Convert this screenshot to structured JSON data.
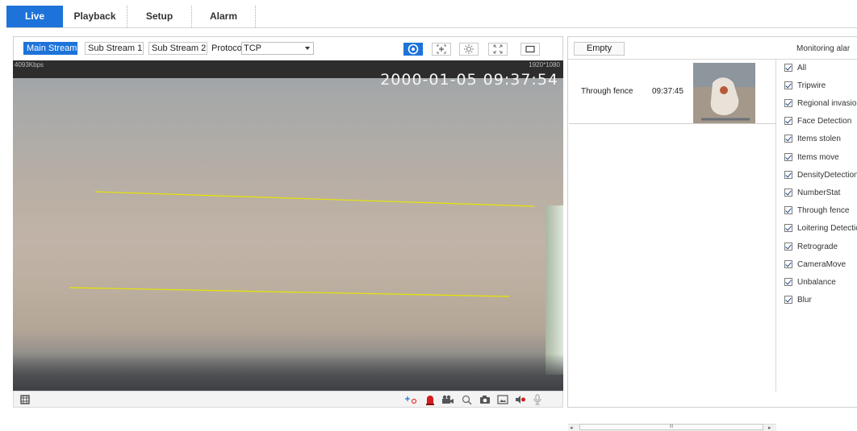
{
  "nav": {
    "tabs": [
      "Live",
      "Playback",
      "Setup",
      "Alarm"
    ],
    "active": "Live"
  },
  "live": {
    "streams": [
      "Main Stream",
      "Sub Stream 1",
      "Sub Stream 2"
    ],
    "active_stream": "Main Stream",
    "protocol_label": "Protocol",
    "protocol_value": "TCP",
    "toolbar_icons": [
      "detection-overlay-icon",
      "zoom-in-icon",
      "image-adjust-icon",
      "fit-window-icon",
      "fullscreen-icon"
    ],
    "overlay": {
      "bitrate": "4093Kbps",
      "resolution": "1920*1080",
      "timestamp": "2000-01-05 09:37:54"
    },
    "bottom_icons": [
      "film-icon",
      "ptz-icon",
      "alarm-light-icon",
      "record-icon",
      "zoom-icon",
      "snapshot-icon",
      "image-icon",
      "audio-mute-icon",
      "microphone-icon"
    ]
  },
  "alarm": {
    "empty_label": "Empty",
    "title": "Monitoring alar",
    "events": [
      {
        "name": "Through fence",
        "time": "09:37:45"
      }
    ],
    "filters": [
      "All",
      "Tripwire",
      "Regional invasion",
      "Face Detection",
      "Items stolen",
      "Items move",
      "DensityDetection",
      "NumberStat",
      "Through fence",
      "Loitering Detection",
      "Retrograde",
      "CameraMove",
      "Unbalance",
      "Blur"
    ],
    "scrollbar_thumb": "III"
  },
  "colors": {
    "accent": "#1d73d9",
    "tripwire": "#e6e600"
  }
}
